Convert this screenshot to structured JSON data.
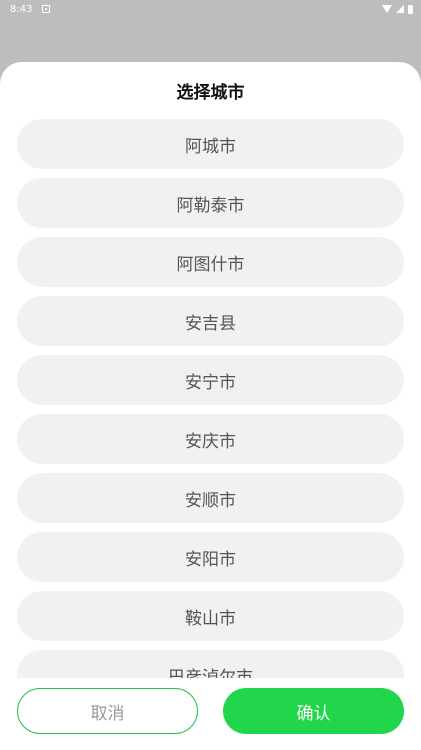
{
  "status_bar": {
    "time": "8:43",
    "icons": [
      "app-notification-icon",
      "wifi-icon",
      "signal-icon",
      "battery-icon"
    ]
  },
  "sheet": {
    "title": "选择城市",
    "cities": [
      "阿城市",
      "阿勒泰市",
      "阿图什市",
      "安吉县",
      "安宁市",
      "安庆市",
      "安顺市",
      "安阳市",
      "鞍山市",
      "巴彦淖尔市"
    ]
  },
  "footer": {
    "cancel_label": "取消",
    "confirm_label": "确认"
  },
  "colors": {
    "overlay": "#bdbdbd",
    "accent": "#22d64b",
    "item_bg": "#f1f1f1"
  }
}
